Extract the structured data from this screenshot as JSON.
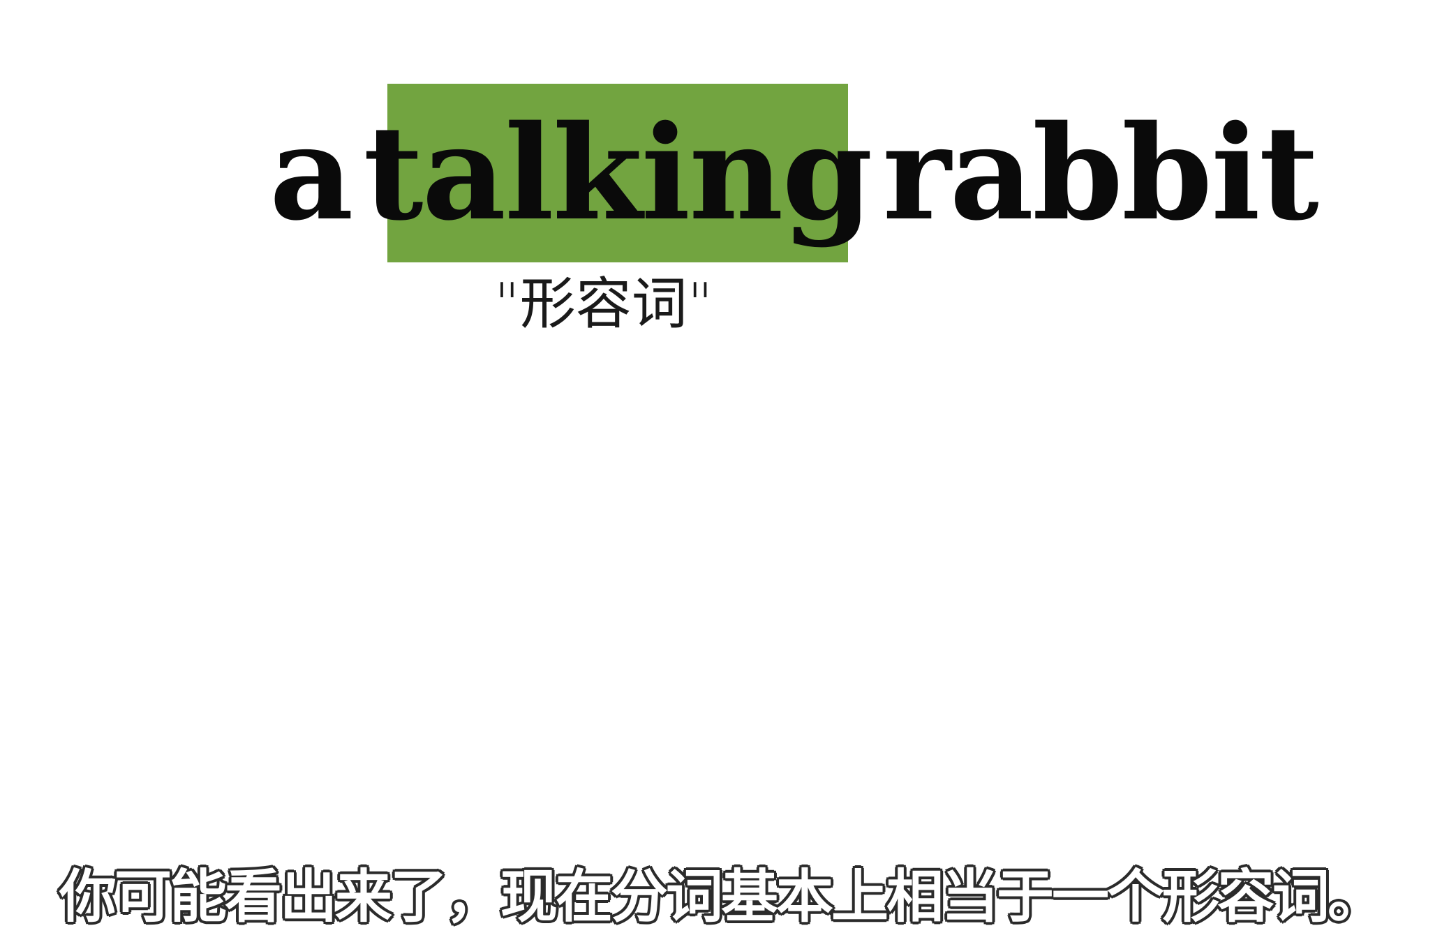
{
  "phrase": {
    "word_article": "a",
    "word_highlighted": "talking",
    "word_noun": "rabbit"
  },
  "annotation": {
    "label": "\"形容词\""
  },
  "subtitle": {
    "text": "你可能看出来了，现在分词基本上相当于一个形容词。"
  },
  "colors": {
    "highlight": "#72a440",
    "text": "#0a0a0a",
    "background": "#ffffff",
    "subtitle_fill": "#ffffff",
    "subtitle_outline": "#2b2b2b"
  }
}
